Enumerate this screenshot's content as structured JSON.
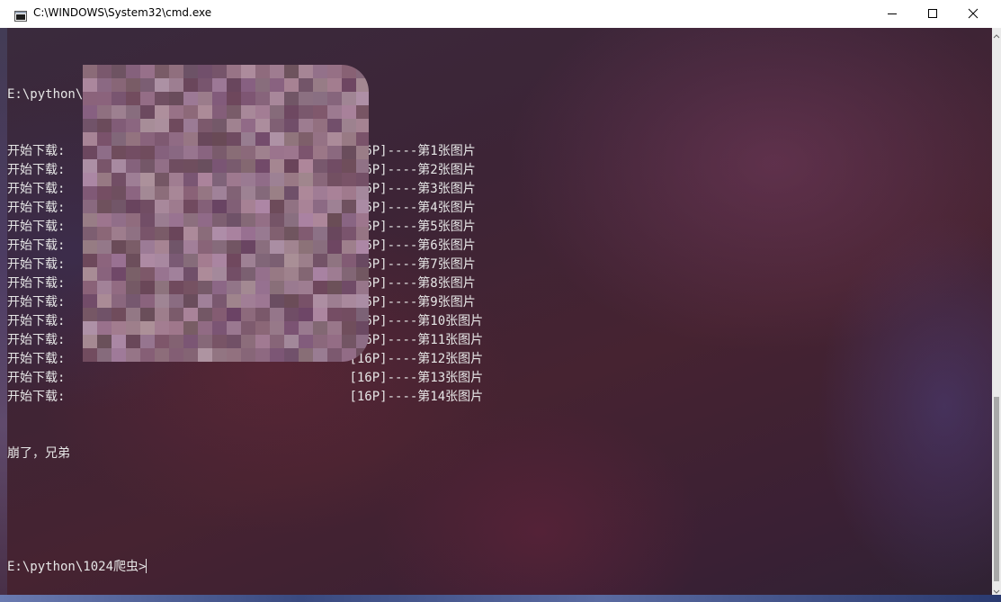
{
  "window": {
    "title": "C:\\WINDOWS\\System32\\cmd.exe",
    "icon": "cmd-icon",
    "controls": {
      "minimize_icon": "minimize-icon",
      "maximize_icon": "maximize-icon",
      "close_icon": "close-icon"
    }
  },
  "console": {
    "text_color": "#e6e6e6",
    "command_line": "E:\\python\\1024爬虫>python 1024.py",
    "download_lines": [
      {
        "prefix": "开始下载:",
        "suffix": "[16P]----第1张图片"
      },
      {
        "prefix": "开始下载:",
        "suffix": "[16P]----第2张图片"
      },
      {
        "prefix": "开始下载:",
        "suffix": "[16P]----第3张图片"
      },
      {
        "prefix": "开始下载:",
        "suffix": "[16P]----第4张图片"
      },
      {
        "prefix": "开始下载:",
        "suffix": "[16P]----第5张图片"
      },
      {
        "prefix": "开始下载:",
        "suffix": "[16P]----第6张图片"
      },
      {
        "prefix": "开始下载:",
        "suffix": "[16P]----第7张图片"
      },
      {
        "prefix": "开始下载:",
        "suffix": "[16P]----第8张图片"
      },
      {
        "prefix": "开始下载:",
        "suffix": "[16P]----第9张图片"
      },
      {
        "prefix": "开始下载:",
        "suffix": "[16P]----第10张图片"
      },
      {
        "prefix": "开始下载:",
        "suffix": "[16P]----第11张图片"
      },
      {
        "prefix": "开始下载:",
        "suffix": "[16P]----第12张图片"
      },
      {
        "prefix": "开始下载:",
        "suffix": "[16P]----第13张图片"
      },
      {
        "prefix": "开始下载:",
        "suffix": "[16P]----第14张图片"
      }
    ],
    "crash_message": "崩了，兄弟",
    "prompt": "E:\\python\\1024爬虫>"
  }
}
